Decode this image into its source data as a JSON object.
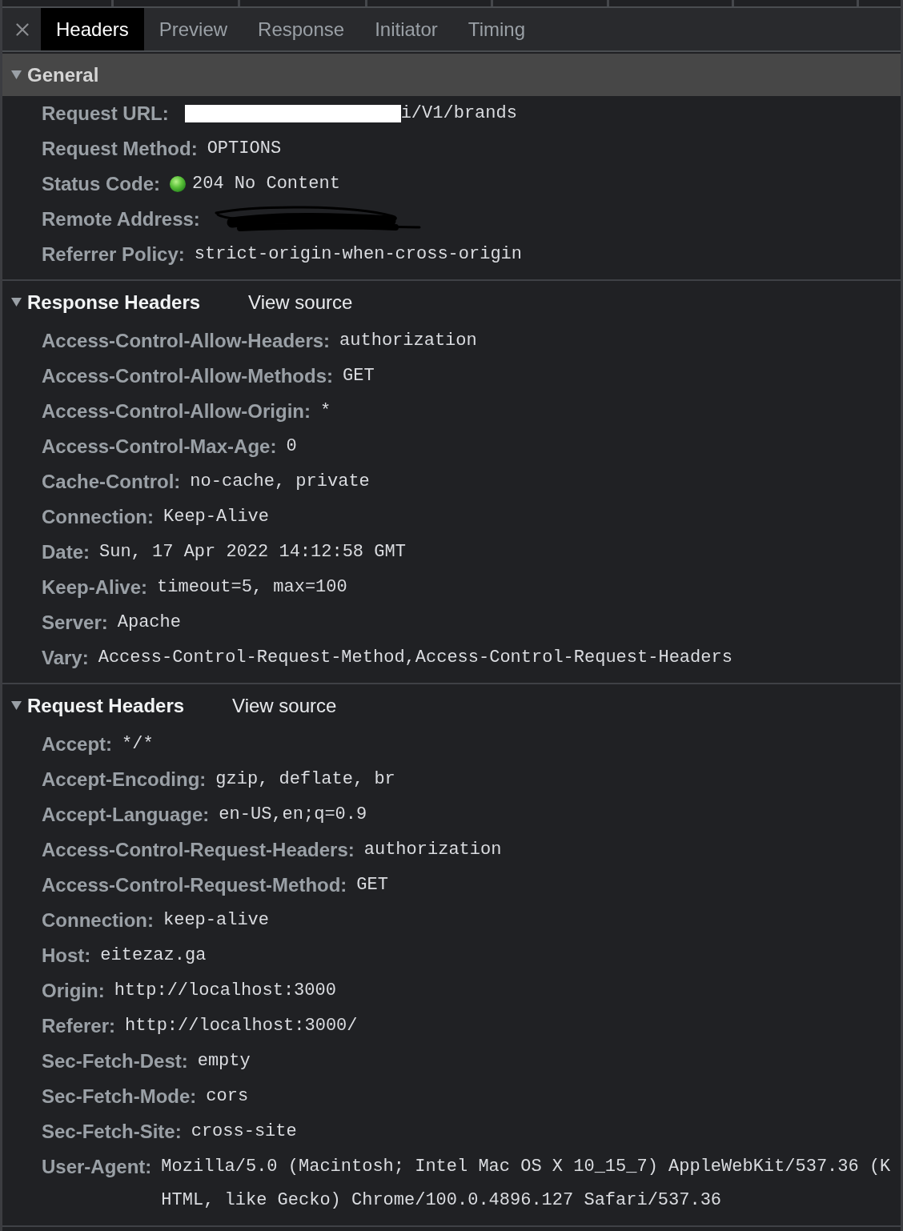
{
  "tabs": [
    {
      "label": "Headers",
      "selected": true
    },
    {
      "label": "Preview",
      "selected": false
    },
    {
      "label": "Response",
      "selected": false
    },
    {
      "label": "Initiator",
      "selected": false
    },
    {
      "label": "Timing",
      "selected": false
    }
  ],
  "sections": [
    {
      "title": "General",
      "expanded": true,
      "selected": true,
      "rows": [
        {
          "kind": "masked",
          "name": "Request URL:",
          "value": "i/V1/brands"
        },
        {
          "kind": "text",
          "name": "Request Method:",
          "value": "OPTIONS"
        },
        {
          "kind": "status",
          "name": "Status Code:",
          "value": "204 No Content"
        },
        {
          "kind": "scribbled",
          "name": "Remote Address:"
        },
        {
          "kind": "text",
          "name": "Referrer Policy:",
          "value": "strict-origin-when-cross-origin"
        }
      ]
    },
    {
      "title": "Response Headers",
      "expanded": true,
      "selected": false,
      "link": "View source",
      "rows": [
        {
          "name": "Access-Control-Allow-Headers:",
          "value": "authorization"
        },
        {
          "name": "Access-Control-Allow-Methods:",
          "value": "GET"
        },
        {
          "name": "Access-Control-Allow-Origin:",
          "value": "*"
        },
        {
          "name": "Access-Control-Max-Age:",
          "value": "0"
        },
        {
          "name": "Cache-Control:",
          "value": "no-cache, private"
        },
        {
          "name": "Connection:",
          "value": "Keep-Alive"
        },
        {
          "name": "Date:",
          "value": "Sun, 17 Apr 2022 14:12:58 GMT"
        },
        {
          "name": "Keep-Alive:",
          "value": "timeout=5, max=100"
        },
        {
          "name": "Server:",
          "value": "Apache"
        },
        {
          "name": "Vary:",
          "value": "Access-Control-Request-Method,Access-Control-Request-Headers"
        }
      ]
    },
    {
      "title": "Request Headers",
      "expanded": true,
      "selected": false,
      "link": "View source",
      "rows": [
        {
          "name": "Accept:",
          "value": "*/*"
        },
        {
          "name": "Accept-Encoding:",
          "value": "gzip, deflate, br"
        },
        {
          "name": "Accept-Language:",
          "value": "en-US,en;q=0.9"
        },
        {
          "name": "Access-Control-Request-Headers:",
          "value": "authorization"
        },
        {
          "name": "Access-Control-Request-Method:",
          "value": "GET"
        },
        {
          "name": "Connection:",
          "value": "keep-alive"
        },
        {
          "name": "Host:",
          "value": "eitezaz.ga"
        },
        {
          "name": "Origin:",
          "value": "http://localhost:3000"
        },
        {
          "name": "Referer:",
          "value": "http://localhost:3000/"
        },
        {
          "name": "Sec-Fetch-Dest:",
          "value": "empty"
        },
        {
          "name": "Sec-Fetch-Mode:",
          "value": "cors"
        },
        {
          "name": "Sec-Fetch-Site:",
          "value": "cross-site"
        },
        {
          "name": "User-Agent:",
          "value": "Mozilla/5.0 (Macintosh; Intel Mac OS X 10_15_7) AppleWebKit/537.36 (KHTML, like Gecko) Chrome/100.0.4896.127 Safari/537.36"
        }
      ]
    }
  ]
}
